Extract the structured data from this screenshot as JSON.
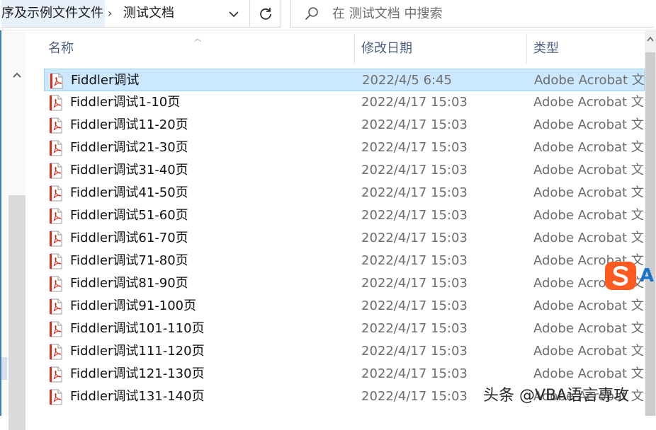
{
  "address": {
    "previous_crumb": "序及示例文件文件",
    "current_folder": "测试文档"
  },
  "search": {
    "placeholder": "在 测试文档 中搜索"
  },
  "columns": {
    "name": "名称",
    "date": "修改日期",
    "type": "类型"
  },
  "files": [
    {
      "name": "Fiddler调试",
      "date": "2022/4/5 6:45",
      "type": "Adobe Acrobat 文",
      "selected": true
    },
    {
      "name": "Fiddler调试1-10页",
      "date": "2022/4/17 15:03",
      "type": "Adobe Acrobat 文"
    },
    {
      "name": "Fiddler调试11-20页",
      "date": "2022/4/17 15:03",
      "type": "Adobe Acrobat 文"
    },
    {
      "name": "Fiddler调试21-30页",
      "date": "2022/4/17 15:03",
      "type": "Adobe Acrobat 文"
    },
    {
      "name": "Fiddler调试31-40页",
      "date": "2022/4/17 15:03",
      "type": "Adobe Acrobat 文"
    },
    {
      "name": "Fiddler调试41-50页",
      "date": "2022/4/17 15:03",
      "type": "Adobe Acrobat 文"
    },
    {
      "name": "Fiddler调试51-60页",
      "date": "2022/4/17 15:03",
      "type": "Adobe Acrobat 文"
    },
    {
      "name": "Fiddler调试61-70页",
      "date": "2022/4/17 15:03",
      "type": "Adobe Acrobat 文"
    },
    {
      "name": "Fiddler调试71-80页",
      "date": "2022/4/17 15:03",
      "type": "Adobe Acrobat 文"
    },
    {
      "name": "Fiddler调试81-90页",
      "date": "2022/4/17 15:03",
      "type": "Adobe Acrobat 文"
    },
    {
      "name": "Fiddler调试91-100页",
      "date": "2022/4/17 15:03",
      "type": "Adobe Acrobat 文"
    },
    {
      "name": "Fiddler调试101-110页",
      "date": "2022/4/17 15:03",
      "type": "Adobe Acrobat 文"
    },
    {
      "name": "Fiddler调试111-120页",
      "date": "2022/4/17 15:03",
      "type": "Adobe Acrobat 文"
    },
    {
      "name": "Fiddler调试121-130页",
      "date": "2022/4/17 15:03",
      "type": "Adobe Acrobat 文"
    },
    {
      "name": "Fiddler调试131-140页",
      "date": "2022/4/17 15:03",
      "type": "Adobe Acrobat 文"
    }
  ],
  "overlay": {
    "ime_letter": "A",
    "watermark": "头条 @VBA语言専攻"
  },
  "colors": {
    "selection_bg": "#cce8ff",
    "selection_border": "#99d1ff",
    "header_text": "#4d6082",
    "pdf_red": "#d92a1c"
  },
  "icons": {
    "file": "pdf-file-icon",
    "refresh": "refresh-icon",
    "search": "search-icon",
    "dropdown": "chevron-down-icon",
    "breadcrumb_separator": "chevron-right-icon",
    "ime": "sogou-ime-icon"
  }
}
